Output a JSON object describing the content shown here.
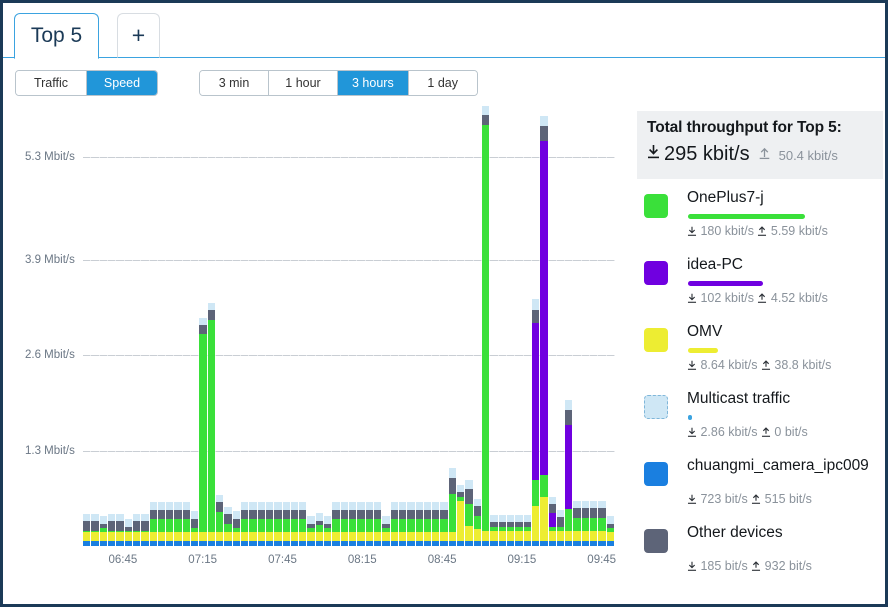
{
  "tabs": [
    {
      "label": "Top 5",
      "active": true
    },
    {
      "label": "+",
      "active": false
    }
  ],
  "toolbar": {
    "mode_buttons": [
      {
        "label": "Traffic",
        "selected": false
      },
      {
        "label": "Speed",
        "selected": true
      }
    ],
    "range_buttons": [
      {
        "label": "3 min",
        "selected": false
      },
      {
        "label": "1 hour",
        "selected": false
      },
      {
        "label": "3 hours",
        "selected": true
      },
      {
        "label": "1 day",
        "selected": false
      }
    ]
  },
  "summary": {
    "title": "Total throughput for Top 5:",
    "download": "295 kbit/s",
    "upload": "50.4 kbit/s",
    "download_icon": "download-arrow-icon",
    "upload_icon": "upload-arrow-icon"
  },
  "legend": [
    {
      "name": "OnePlus7-j",
      "color": "#3ae03a",
      "meter_pct": 59,
      "download": "180 kbit/s",
      "upload": "5.59 kbit/s"
    },
    {
      "name": "idea-PC",
      "color": "#7000e0",
      "meter_pct": 38,
      "download": "102 kbit/s",
      "upload": "4.52 kbit/s"
    },
    {
      "name": "OMV",
      "color": "#eded32",
      "meter_pct": 15,
      "download": "8.64 kbit/s",
      "upload": "38.8 kbit/s"
    },
    {
      "name": "Multicast traffic",
      "color": "#cfe7f5",
      "meter_pct": 2,
      "download": "2.86 kbit/s",
      "upload": "0 bit/s",
      "dashed": true,
      "meter_color": "#3ba3e0"
    },
    {
      "name": "chuangmi_camera_ipc009",
      "color": "#1a7fe0",
      "meter_pct": 0,
      "download": "723 bit/s",
      "upload": "515 bit/s"
    },
    {
      "name": "Other devices",
      "color": "#5d6478",
      "meter_pct": 0,
      "download": "185 bit/s",
      "upload": "932 bit/s"
    }
  ],
  "chart_data": {
    "type": "bar",
    "stacked": true,
    "title": "",
    "xlabel": "",
    "ylabel": "",
    "grid": true,
    "ylim": [
      0,
      6.0
    ],
    "y_unit": "Mbit/s",
    "y_ticks": [
      1.3,
      2.6,
      3.9,
      5.3
    ],
    "y_tick_labels": [
      "1.3 Mbit/s",
      "2.6 Mbit/s",
      "3.9 Mbit/s",
      "5.3 Mbit/s"
    ],
    "x_tick_labels": [
      "06:45",
      "07:15",
      "07:45",
      "08:15",
      "08:45",
      "09:15",
      "09:45"
    ],
    "x_tick_positions": [
      0.075,
      0.225,
      0.375,
      0.525,
      0.675,
      0.825,
      0.975
    ],
    "legend_position": "right",
    "series": [
      {
        "name": "chuangmi_camera_ipc009",
        "color": "#1a7fe0",
        "values": [
          0.075,
          0.075,
          0.075,
          0.075,
          0.075,
          0.075,
          0.075,
          0.075,
          0.075,
          0.075,
          0.075,
          0.075,
          0.075,
          0.075,
          0.075,
          0.075,
          0.075,
          0.075,
          0.075,
          0.075,
          0.075,
          0.075,
          0.075,
          0.075,
          0.075,
          0.075,
          0.075,
          0.075,
          0.075,
          0.075,
          0.075,
          0.075,
          0.075,
          0.075,
          0.075,
          0.075,
          0.075,
          0.075,
          0.075,
          0.075,
          0.075,
          0.075,
          0.075,
          0.075,
          0.075,
          0.075,
          0.075,
          0.075,
          0.075,
          0.075,
          0.075,
          0.075,
          0.075,
          0.075,
          0.075,
          0.075,
          0.075,
          0.075,
          0.075,
          0.075,
          0.075,
          0.075,
          0.075,
          0.075
        ]
      },
      {
        "name": "OMV",
        "color": "#eded32",
        "values": [
          0.11,
          0.11,
          0.11,
          0.11,
          0.11,
          0.11,
          0.11,
          0.11,
          0.11,
          0.11,
          0.11,
          0.11,
          0.11,
          0.11,
          0.11,
          0.11,
          0.11,
          0.11,
          0.11,
          0.11,
          0.11,
          0.11,
          0.11,
          0.11,
          0.11,
          0.11,
          0.11,
          0.11,
          0.11,
          0.11,
          0.11,
          0.11,
          0.11,
          0.11,
          0.11,
          0.11,
          0.11,
          0.11,
          0.11,
          0.11,
          0.11,
          0.11,
          0.11,
          0.11,
          0.11,
          0.54,
          0.2,
          0.16,
          0.13,
          0.13,
          0.13,
          0.13,
          0.13,
          0.13,
          0.47,
          0.6,
          0.13,
          0.13,
          0.13,
          0.13,
          0.13,
          0.13,
          0.13,
          0.11
        ]
      },
      {
        "name": "OnePlus7-j",
        "color": "#3ae03a",
        "values": [
          0.02,
          0.02,
          0.06,
          0.02,
          0.02,
          0.02,
          0.02,
          0.02,
          0.18,
          0.18,
          0.18,
          0.18,
          0.18,
          0.06,
          2.7,
          2.9,
          0.28,
          0.12,
          0.06,
          0.18,
          0.18,
          0.18,
          0.18,
          0.18,
          0.18,
          0.18,
          0.18,
          0.06,
          0.1,
          0.06,
          0.18,
          0.18,
          0.18,
          0.18,
          0.18,
          0.18,
          0.06,
          0.18,
          0.18,
          0.18,
          0.18,
          0.18,
          0.18,
          0.18,
          0.52,
          0.06,
          0.3,
          0.18,
          5.55,
          0.06,
          0.06,
          0.06,
          0.06,
          0.06,
          0.35,
          0.3,
          0.06,
          0.06,
          0.3,
          0.18,
          0.18,
          0.18,
          0.18,
          0.06
        ]
      },
      {
        "name": "idea-PC",
        "color": "#7000e0",
        "values": [
          0,
          0,
          0,
          0,
          0,
          0,
          0,
          0,
          0,
          0,
          0,
          0,
          0,
          0,
          0,
          0,
          0,
          0,
          0,
          0,
          0,
          0,
          0,
          0,
          0,
          0,
          0,
          0,
          0,
          0,
          0,
          0,
          0,
          0,
          0,
          0,
          0,
          0,
          0,
          0,
          0,
          0,
          0,
          0,
          0,
          0,
          0,
          0,
          0,
          0,
          0,
          0,
          0,
          0,
          2.15,
          4.55,
          0.18,
          0,
          1.15,
          0,
          0,
          0,
          0,
          0
        ]
      },
      {
        "name": "Other devices",
        "color": "#5d6478",
        "values": [
          0.13,
          0.13,
          0.06,
          0.13,
          0.13,
          0.06,
          0.13,
          0.13,
          0.13,
          0.13,
          0.13,
          0.13,
          0.13,
          0.13,
          0.13,
          0.13,
          0.13,
          0.13,
          0.13,
          0.13,
          0.13,
          0.13,
          0.13,
          0.13,
          0.13,
          0.13,
          0.13,
          0.06,
          0.06,
          0.06,
          0.13,
          0.13,
          0.13,
          0.13,
          0.13,
          0.13,
          0.06,
          0.13,
          0.13,
          0.13,
          0.13,
          0.13,
          0.13,
          0.13,
          0.22,
          0.06,
          0.2,
          0.13,
          0.14,
          0.06,
          0.06,
          0.06,
          0.06,
          0.06,
          0.18,
          0.2,
          0.13,
          0.13,
          0.2,
          0.13,
          0.13,
          0.13,
          0.13,
          0.06
        ]
      },
      {
        "name": "Multicast traffic",
        "color": "#cfe7f5",
        "values": [
          0.1,
          0.1,
          0.1,
          0.1,
          0.1,
          0.1,
          0.1,
          0.1,
          0.1,
          0.1,
          0.1,
          0.1,
          0.1,
          0.1,
          0.1,
          0.1,
          0.1,
          0.1,
          0.1,
          0.1,
          0.1,
          0.1,
          0.1,
          0.1,
          0.1,
          0.1,
          0.1,
          0.1,
          0.1,
          0.1,
          0.1,
          0.1,
          0.1,
          0.1,
          0.1,
          0.1,
          0.1,
          0.1,
          0.1,
          0.1,
          0.1,
          0.1,
          0.1,
          0.1,
          0.14,
          0.1,
          0.12,
          0.1,
          0.12,
          0.1,
          0.1,
          0.1,
          0.1,
          0.1,
          0.14,
          0.14,
          0.1,
          0.1,
          0.14,
          0.1,
          0.1,
          0.1,
          0.1,
          0.1
        ]
      }
    ]
  }
}
